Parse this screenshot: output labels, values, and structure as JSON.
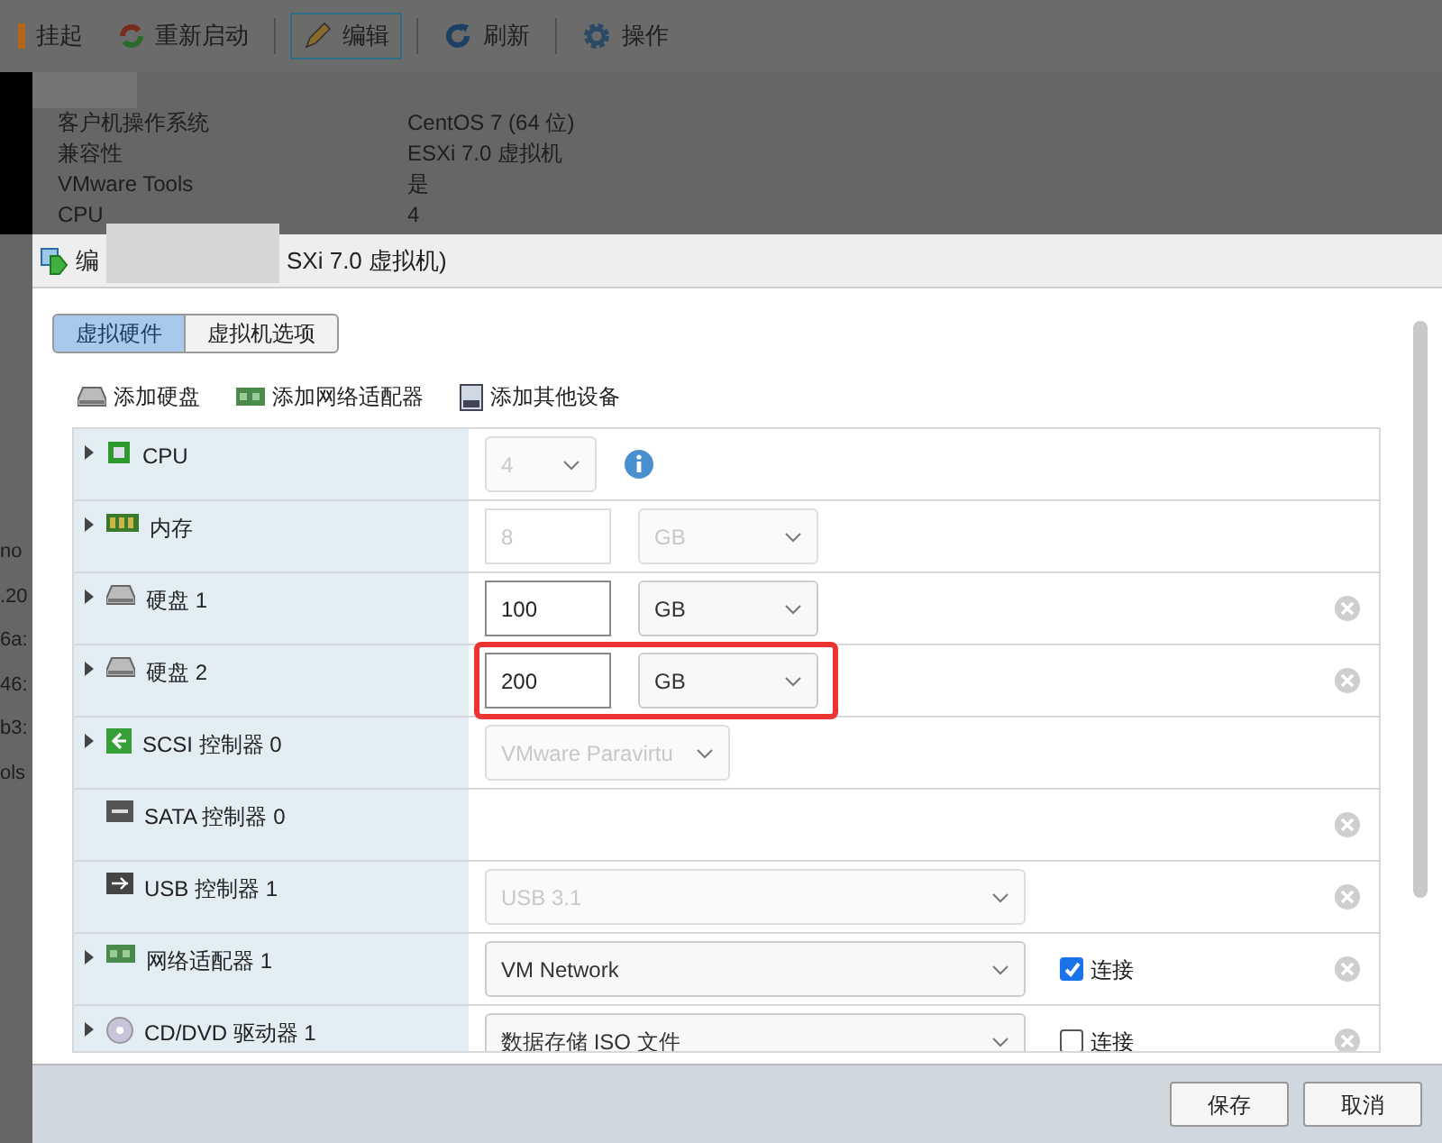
{
  "toolbar": [
    {
      "label": "挂起",
      "kind": "suspend",
      "selected": false
    },
    {
      "label": "重新启动",
      "kind": "restart",
      "selected": false
    },
    {
      "label": "编辑",
      "kind": "edit",
      "selected": true
    },
    {
      "label": "刷新",
      "kind": "refresh",
      "selected": false
    },
    {
      "label": "操作",
      "kind": "actions",
      "selected": false
    }
  ],
  "vm_info": [
    {
      "label": "客户机操作系统",
      "value": "CentOS 7 (64 位)"
    },
    {
      "label": "兼容性",
      "value": "ESXi 7.0 虚拟机"
    },
    {
      "label": "VMware Tools",
      "value": "是"
    },
    {
      "label": "CPU",
      "value": "4"
    }
  ],
  "background_fragments": [
    "no",
    ".20",
    "6a:",
    "46:",
    "b3:",
    "ols"
  ],
  "dialog": {
    "title_start": "编",
    "title_end": "SXi 7.0 虚拟机)",
    "tabs": [
      {
        "label": "虚拟硬件",
        "selected": true
      },
      {
        "label": "虚拟机选项",
        "selected": false
      }
    ],
    "add_actions": [
      {
        "label": "添加硬盘",
        "kind": "disk"
      },
      {
        "label": "添加网络适配器",
        "kind": "network"
      },
      {
        "label": "添加其他设备",
        "kind": "other"
      }
    ],
    "devices": [
      {
        "name": "CPU",
        "kind": "cpu",
        "expandable": true,
        "highlighted": false,
        "removable": false,
        "controls": [
          {
            "kind": "select",
            "value": "4",
            "disabled": true
          },
          {
            "kind": "info"
          }
        ]
      },
      {
        "name": "内存",
        "kind": "memory",
        "expandable": true,
        "highlighted": false,
        "removable": false,
        "controls": [
          {
            "kind": "input",
            "value": "8",
            "disabled": true
          },
          {
            "kind": "select",
            "value": "GB",
            "disabled": true
          }
        ]
      },
      {
        "name": "硬盘 1",
        "kind": "disk",
        "expandable": true,
        "highlighted": false,
        "removable": true,
        "controls": [
          {
            "kind": "input",
            "value": "100",
            "disabled": false
          },
          {
            "kind": "select",
            "value": "GB",
            "disabled": false
          }
        ]
      },
      {
        "name": "硬盘 2",
        "kind": "disk",
        "expandable": true,
        "highlighted": true,
        "removable": true,
        "controls": [
          {
            "kind": "input",
            "value": "200",
            "disabled": false
          },
          {
            "kind": "select",
            "value": "GB",
            "disabled": false
          }
        ]
      },
      {
        "name": "SCSI 控制器 0",
        "kind": "scsi",
        "expandable": true,
        "highlighted": false,
        "removable": false,
        "controls": [
          {
            "kind": "select",
            "value": "VMware Paravirtu",
            "disabled": true
          }
        ]
      },
      {
        "name": "SATA 控制器 0",
        "kind": "sata",
        "expandable": false,
        "highlighted": false,
        "removable": true
      },
      {
        "name": "USB 控制器 1",
        "kind": "usb",
        "expandable": false,
        "highlighted": false,
        "removable": true,
        "controls": [
          {
            "kind": "select",
            "value": "USB 3.1",
            "disabled": true
          }
        ]
      },
      {
        "name": "网络适配器 1",
        "kind": "network",
        "expandable": true,
        "highlighted": false,
        "removable": true,
        "controls": [
          {
            "kind": "select",
            "value": "VM Network",
            "disabled": false
          },
          {
            "kind": "checkbox",
            "label": "连接",
            "checked": true
          }
        ]
      },
      {
        "name": "CD/DVD 驱动器 1",
        "kind": "cdrom",
        "expandable": true,
        "highlighted": false,
        "removable": true,
        "controls": [
          {
            "kind": "select",
            "value": "数据存储 ISO 文件",
            "disabled": false
          },
          {
            "kind": "checkbox",
            "label": "连接",
            "checked": false
          }
        ]
      }
    ],
    "buttons": [
      "保存",
      "取消"
    ]
  }
}
